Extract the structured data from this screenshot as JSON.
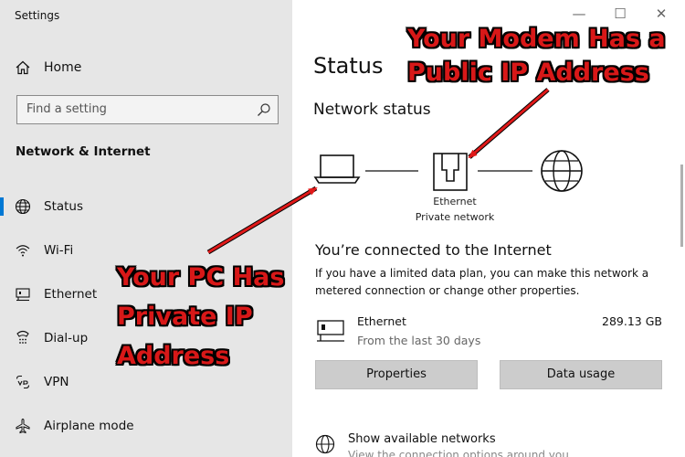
{
  "window": {
    "app_title": "Settings",
    "controls": {
      "minimize": "—",
      "maximize": "☐",
      "close": "✕"
    }
  },
  "sidebar": {
    "home_label": "Home",
    "search_placeholder": "Find a setting",
    "section_title": "Network & Internet",
    "items": [
      {
        "label": "Status",
        "icon": "globe-icon",
        "active": true
      },
      {
        "label": "Wi-Fi",
        "icon": "wifi-icon",
        "active": false
      },
      {
        "label": "Ethernet",
        "icon": "ethernet-icon",
        "active": false
      },
      {
        "label": "Dial-up",
        "icon": "dialup-icon",
        "active": false
      },
      {
        "label": "VPN",
        "icon": "vpn-icon",
        "active": false
      },
      {
        "label": "Airplane mode",
        "icon": "airplane-icon",
        "active": false
      }
    ]
  },
  "main": {
    "title": "Status",
    "network_status_heading": "Network status",
    "diagram": {
      "adapter_label": "Ethernet",
      "network_label": "Private network"
    },
    "connected_heading": "You’re connected to the Internet",
    "connected_desc": "If you have a limited data plan, you can make this network a metered connection or change other properties.",
    "usage": {
      "name": "Ethernet",
      "period": "From the last 30 days",
      "amount": "289.13 GB"
    },
    "buttons": {
      "properties": "Properties",
      "data_usage": "Data usage"
    },
    "show_networks": {
      "title": "Show available networks",
      "subtitle": "View the connection options around you."
    }
  },
  "annotations": {
    "modem_line1": "Your Modem Has a",
    "modem_line2": "Public IP Address",
    "pc_line1": "Your PC Has",
    "pc_line2": "Private IP",
    "pc_line3": "Address"
  },
  "colors": {
    "accent": "#0078d4",
    "annotation_red": "#d81818",
    "sidebar_bg": "#e6e6e6"
  }
}
